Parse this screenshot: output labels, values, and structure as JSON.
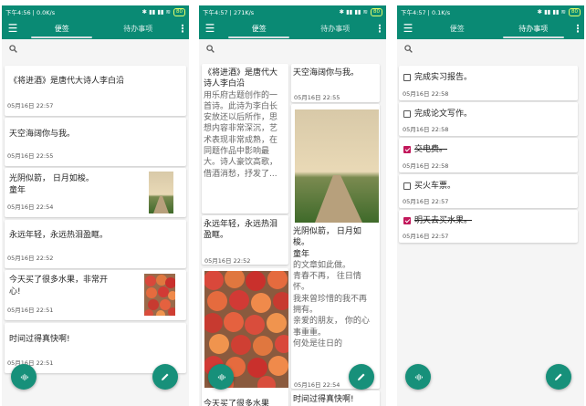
{
  "status": {
    "time_1": "下午4:56",
    "speed_1": "0.0K/s",
    "time_2": "下午4:57",
    "speed_2": "271K/s",
    "time_3": "下午4:57",
    "speed_3": "0.1K/s",
    "signal": "✱ ▮▮ ▮▮ ≋",
    "battery_1": "80",
    "battery_2": "80",
    "battery_3": "80"
  },
  "tabs": {
    "notes": "便签",
    "todo": "待办事项"
  },
  "icons": {
    "menu": "menu-icon",
    "more": "more-vert-icon",
    "search": "search-icon",
    "mic": "mic-icon",
    "edit": "edit-icon"
  },
  "colors": {
    "accent": "#0a8a74",
    "checked": "#c2185b"
  },
  "notes": [
    {
      "text": "《将进酒》是唐代大诗人李白沿",
      "date": "05月16日 22:57"
    },
    {
      "text": "天空海阔你与我。",
      "date": "05月16日 22:55"
    },
    {
      "text": "光阴似箭， 日月如梭。",
      "text2": "童年",
      "date": "05月16日 22:54"
    },
    {
      "text": "永远年轻，永远热泪盈眶。",
      "date": "05月16日 22:52"
    },
    {
      "text": "今天买了很多水果，非常开",
      "text2": "心!",
      "date": "05月16日 22:51"
    },
    {
      "text": "时间过得真快啊!",
      "date": "05月16日 22:51"
    }
  ],
  "grid": {
    "left": [
      {
        "lines": [
          "《将进酒》是唐代大",
          "诗人李白沿"
        ],
        "grey_lines": [
          "用乐府古题创作的一",
          "首诗。此诗为李白长",
          "安放还以后所作，思",
          "想内容非常深沉，艺",
          "术表现非常成熟，在",
          "同题作品中影响最",
          "大。诗人豪饮高歌，",
          "借酒消愁，抒发了..."
        ]
      },
      {
        "lines": [
          "永远年轻，永远热泪",
          "盈眶。"
        ],
        "date": "05月16日 22:52"
      },
      {
        "lines": [
          "今天买了很多水果"
        ]
      }
    ],
    "right": [
      {
        "lines": [
          "天空海阔你与我。"
        ],
        "date": "05月16日 22:55"
      },
      {
        "lines": [
          "光阴似箭， 日月如",
          "梭。",
          "童年"
        ],
        "grey_lines": [
          "的文章如此做。",
          "青春不再， 往日情",
          "怀。",
          "我来曾珍惜的我不再",
          "拥有。",
          "亲爱的朋友， 你的心",
          "事重重。",
          "何处是往日的"
        ],
        "date": "05月16日 22:54"
      },
      {
        "lines": [
          "时间过得真快啊!"
        ]
      }
    ]
  },
  "todos": [
    {
      "text": "完成实习报告。",
      "date": "05月16日 22:58",
      "done": false
    },
    {
      "text": "完成论文写作。",
      "date": "05月16日 22:58",
      "done": false
    },
    {
      "text": "交电费。",
      "date": "05月16日 22:58",
      "done": true
    },
    {
      "text": "买火车票。",
      "date": "05月16日 22:57",
      "done": false
    },
    {
      "text": "明天去买水果。",
      "date": "05月16日 22:57",
      "done": true
    }
  ]
}
